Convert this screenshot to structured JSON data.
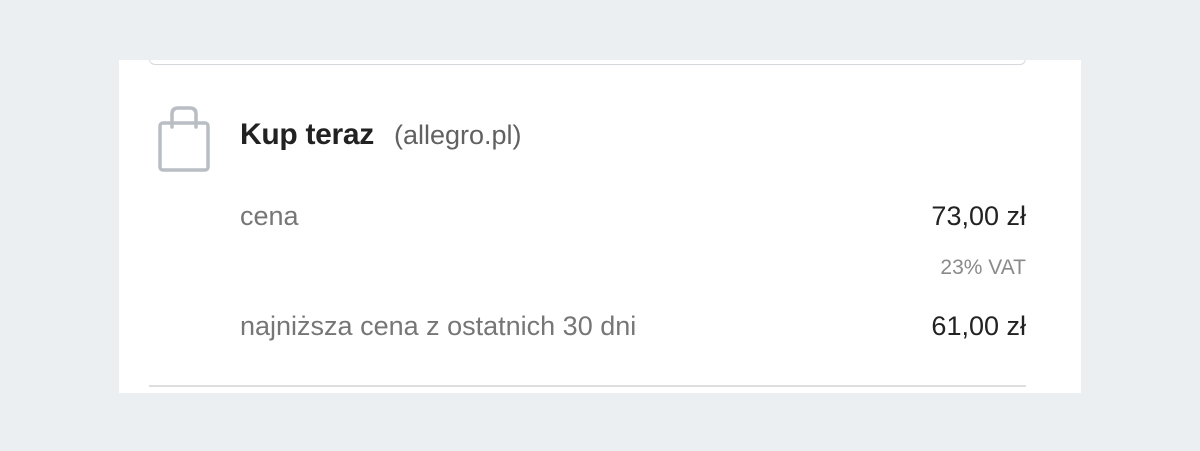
{
  "offer": {
    "title": "Kup teraz",
    "source": "(allegro.pl)",
    "icon": "shopping-bag-icon",
    "price_label": "cena",
    "price_value": "73,00 zł",
    "vat_note": "23% VAT",
    "lowest_label": "najniższa cena z ostatnich 30 dni",
    "lowest_value": "61,00 zł"
  },
  "colors": {
    "background": "#eceff2",
    "card": "#ffffff",
    "icon": "#b9bec4",
    "title": "#222222",
    "muted": "#767676"
  }
}
